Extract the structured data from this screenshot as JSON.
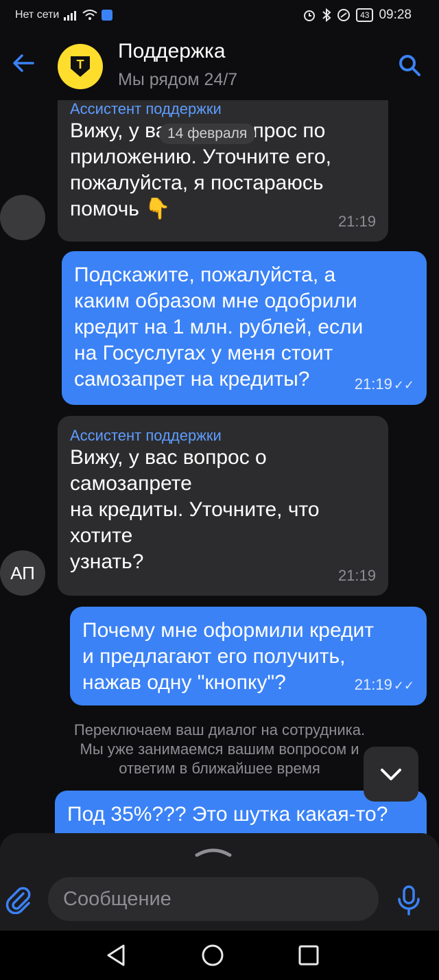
{
  "status_bar": {
    "network": "Нет сети",
    "battery": "43",
    "time": "09:28"
  },
  "header": {
    "title": "Поддержка",
    "subtitle": "Мы рядом 24/7",
    "logo_letter": "T"
  },
  "date_divider": "14 февраля",
  "messages": [
    {
      "sender": "Ассистент поддержки",
      "lines": [
        "Вижу, у вас есть вопрос по",
        "приложению. Уточните его,",
        "пожалуйста, я постараюсь",
        "помочь 👇"
      ],
      "time": "21:19"
    },
    {
      "lines": [
        "Подскажите, пожалуйста, а",
        "каким образом мне одобрили",
        "кредит на 1 млн. рублей, если",
        "на Госуслугах у меня стоит",
        "самозапрет на кредиты?"
      ],
      "time": "21:19",
      "status": "✓✓"
    },
    {
      "sender": "Ассистент поддержки",
      "lines": [
        "Вижу, у вас вопрос о",
        "самозапрете",
        "на кредиты. Уточните, что",
        "хотите",
        "узнать?"
      ],
      "time": "21:19"
    },
    {
      "lines": [
        "Почему мне оформили кредит",
        "и предлагают его получить,",
        "нажав одну \"кнопку\"?"
      ],
      "time": "21:19",
      "status": "✓✓"
    },
    {
      "lines": [
        "Под 35%??? Это шутка какая-то?"
      ]
    }
  ],
  "avatar_initials": "АП",
  "system_message": [
    "Переключаем ваш диалог на сотрудника.",
    "Мы уже занимаемся вашим вопросом и",
    "ответим в ближайшее время"
  ],
  "input": {
    "placeholder": "Сообщение"
  },
  "colors": {
    "background": "#0d0d0f",
    "incoming_bubble": "#2c2c2e",
    "outgoing_bubble": "#3b82f6",
    "accent": "#3b82f6",
    "brand": "#ffdd2d"
  }
}
